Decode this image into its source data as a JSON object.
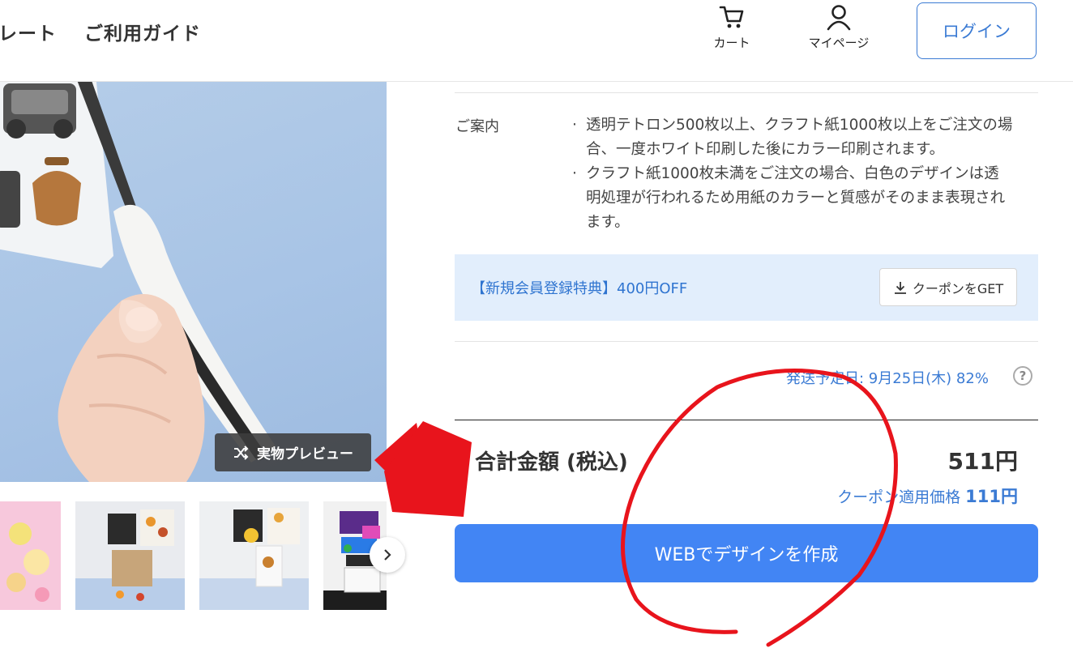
{
  "header": {
    "nav_items": [
      "レート",
      "ご利用ガイド"
    ],
    "cart_label": "カート",
    "mypage_label": "マイページ",
    "login_label": "ログイン"
  },
  "gallery": {
    "preview_label": "実物プレビュー"
  },
  "info": {
    "label": "ご案内",
    "notes": [
      [
        "透明テトロン500枚以上、クラフト紙1000枚以上をご注文の場",
        "合、一度ホワイト印刷した後にカラー印刷されます。"
      ],
      [
        "クラフト紙1000枚未満をご注文の場合、白色のデザインは透",
        "明処理が行われるため用紙のカラーと質感がそのまま表現され",
        "ます。"
      ]
    ]
  },
  "coupon": {
    "text": "【新規会員登録特典】400円OFF",
    "button_label": "クーポンをGET"
  },
  "shipping": {
    "text": "発送予定日: 9月25日(木) 82%"
  },
  "total": {
    "label": "合計金額 (税込)",
    "value": "511円",
    "coupon_label": "クーポン適用価格",
    "coupon_value": "111円"
  },
  "cta": {
    "label": "WEBでデザインを作成"
  },
  "colors": {
    "accent": "#4285f4",
    "link": "#3b7bd4",
    "coupon_bg": "#e2eefc",
    "annotation": "#e8141c"
  }
}
